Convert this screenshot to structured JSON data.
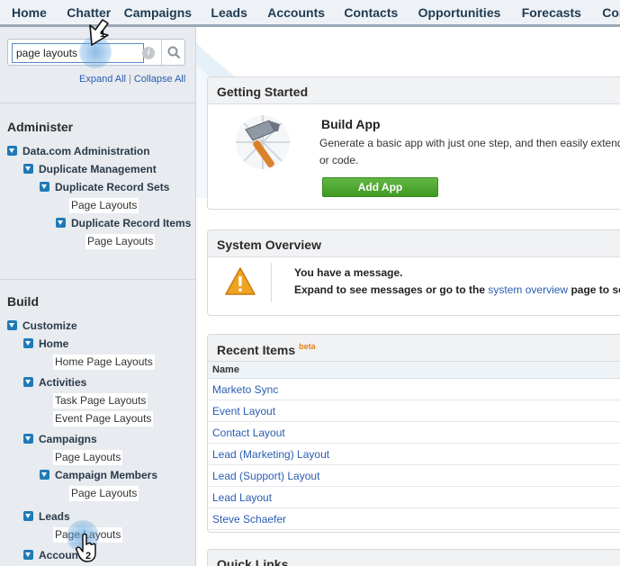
{
  "nav": {
    "tabs": [
      "Home",
      "Chatter",
      "Campaigns",
      "Leads",
      "Accounts",
      "Contacts",
      "Opportunities",
      "Forecasts",
      "Contracts"
    ]
  },
  "sidebar": {
    "search_value": "page layouts",
    "expand_all": "Expand All",
    "separator": "|",
    "collapse_all": "Collapse All",
    "administer": {
      "title": "Administer",
      "datacom": "Data.com Administration",
      "duplicate_management": "Duplicate Management",
      "duplicate_record_sets": "Duplicate Record Sets",
      "drs_page_layouts": "Page Layouts",
      "duplicate_record_items": "Duplicate Record Items",
      "dri_page_layouts": "Page Layouts"
    },
    "build": {
      "title": "Build",
      "customize": "Customize",
      "home": "Home",
      "home_page_layouts": "Home Page Layouts",
      "activities": "Activities",
      "task_page_layouts": "Task Page Layouts",
      "event_page_layouts": "Event Page Layouts",
      "campaigns": "Campaigns",
      "campaigns_page_layouts": "Page Layouts",
      "campaign_members": "Campaign Members",
      "campaign_members_page_layouts": "Page Layouts",
      "leads": "Leads",
      "leads_page_layouts": "Page Layouts",
      "accounts": "Accounts"
    }
  },
  "main": {
    "getting_started": {
      "title": "Getting Started",
      "heading": "Build App",
      "desc_line1": "Generate a basic app with just one step, and then easily extend",
      "desc_line2": "or code.",
      "button": "Add App"
    },
    "system_overview": {
      "title": "System Overview",
      "message": "You have a message.",
      "line2_prefix": "Expand to see messages or go to the",
      "link": "system overview",
      "line2_suffix": "page to see"
    },
    "recent_items": {
      "title": "Recent Items",
      "badge": "beta",
      "column": "Name",
      "items": [
        "Marketo Sync",
        "Event Layout",
        "Contact Layout",
        "Lead (Marketing) Layout",
        "Lead (Support) Layout",
        "Lead Layout",
        "Steve Schaefer"
      ]
    },
    "quick_links": {
      "title": "Quick Links"
    }
  },
  "markers": {
    "step1": "1",
    "step2": "2"
  },
  "colors": {
    "accent": "#1f7ab8",
    "link": "#2a5db0",
    "button": "#4aa52d"
  }
}
